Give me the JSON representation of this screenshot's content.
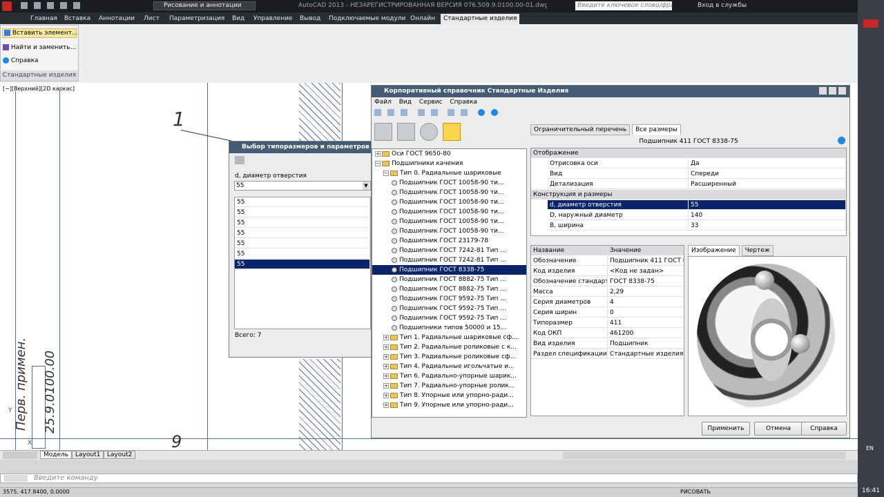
{
  "app": {
    "title": "AutoCAD 2013 - НЕЗАРЕГИСТРИРОВАННАЯ ВЕРСИЯ    076.509.9.0100.00-01.dwg",
    "workspace": "Рисование и аннотации",
    "search_placeholder": "Введите ключевое слово/фразу",
    "signin": "Вход в службы"
  },
  "ribbon_tabs": [
    "Главная",
    "Вставка",
    "Аннотации",
    "Лист",
    "Параметризация",
    "Вид",
    "Управление",
    "Вывод",
    "Подключаемые модули",
    "Онлайн",
    "Стандартные изделия"
  ],
  "panel": {
    "items": [
      "Вставить элемент...",
      "Найти и заменить...",
      "Справка"
    ],
    "title": "Стандартные изделия"
  },
  "viewport_label": "[−][Верхний][2D каркас]",
  "drawing": {
    "leader_1": "1",
    "leader_9": "9",
    "vert_text_1": "Перв. примен.",
    "vert_text_2": "25.9.0100.00",
    "axis_y": "Y",
    "axis_x": "X"
  },
  "param_dialog": {
    "title": "Выбор типоразмеров и параметров",
    "field_label": "d, диаметр отверстия",
    "field_value": "55",
    "list": [
      "55",
      "55",
      "55",
      "55",
      "55",
      "55",
      "55"
    ],
    "selected_index": 6,
    "total": "Всего: 7"
  },
  "main_dialog": {
    "title": "Корпоративный справочник Стандартные Изделия",
    "menu": [
      "Файл",
      "Вид",
      "Сервис",
      "Справка"
    ],
    "tabs": [
      "Ограничительный перечень",
      "Все размеры"
    ],
    "header": "Подшипник 411 ГОСТ 8338-75",
    "tree": [
      {
        "level": 1,
        "icon": "folder",
        "exp": "+",
        "text": "Оси ГОСТ 9650-80"
      },
      {
        "level": 1,
        "icon": "folder",
        "exp": "−",
        "text": "Подшипники качения"
      },
      {
        "level": 2,
        "icon": "folder",
        "exp": "−",
        "text": "Тип 0. Радиальные шариковые"
      },
      {
        "level": 3,
        "icon": "part",
        "text": "Подшипник ГОСТ 10058-90 ти..."
      },
      {
        "level": 3,
        "icon": "part",
        "text": "Подшипник ГОСТ 10058-90 ти..."
      },
      {
        "level": 3,
        "icon": "part",
        "text": "Подшипник ГОСТ 10058-90 ти..."
      },
      {
        "level": 3,
        "icon": "part",
        "text": "Подшипник ГОСТ 10058-90 ти..."
      },
      {
        "level": 3,
        "icon": "part",
        "text": "Подшипник ГОСТ 10058-90 ти..."
      },
      {
        "level": 3,
        "icon": "part",
        "text": "Подшипник ГОСТ 10058-90 ти..."
      },
      {
        "level": 3,
        "icon": "part",
        "text": "Подшипник ГОСТ 23179-78"
      },
      {
        "level": 3,
        "icon": "part",
        "text": "Подшипник ГОСТ 7242-81 Тип ..."
      },
      {
        "level": 3,
        "icon": "part",
        "text": "Подшипник ГОСТ 7242-81 Тип ..."
      },
      {
        "level": 3,
        "icon": "part",
        "text": "Подшипник ГОСТ 8338-75",
        "selected": true
      },
      {
        "level": 3,
        "icon": "part",
        "text": "Подшипник ГОСТ 8882-75 Тип ..."
      },
      {
        "level": 3,
        "icon": "part",
        "text": "Подшипник ГОСТ 8882-75 Тип ..."
      },
      {
        "level": 3,
        "icon": "part",
        "text": "Подшипник ГОСТ 9592-75 Тип ..."
      },
      {
        "level": 3,
        "icon": "part",
        "text": "Подшипник ГОСТ 9592-75 Тип ..."
      },
      {
        "level": 3,
        "icon": "part",
        "text": "Подшипник ГОСТ 9592-75 Тип ..."
      },
      {
        "level": 3,
        "icon": "part",
        "text": "Подшипники типов 50000 и 15..."
      },
      {
        "level": 2,
        "icon": "folder",
        "exp": "+",
        "text": "Тип 1. Радиальные шариковые сф..."
      },
      {
        "level": 2,
        "icon": "folder",
        "exp": "+",
        "text": "Тип 2. Радиальные роликовые с к..."
      },
      {
        "level": 2,
        "icon": "folder",
        "exp": "+",
        "text": "Тип 3. Радиальные роликовые сф..."
      },
      {
        "level": 2,
        "icon": "folder",
        "exp": "+",
        "text": "Тип 4. Радиальные игольчатые и..."
      },
      {
        "level": 2,
        "icon": "folder",
        "exp": "+",
        "text": "Тип 6. Радиально-упорные шарик..."
      },
      {
        "level": 2,
        "icon": "folder",
        "exp": "+",
        "text": "Тип 7. Радиально-упорные ролик..."
      },
      {
        "level": 2,
        "icon": "folder",
        "exp": "+",
        "text": "Тип 8. Упорные или упорно-ради..."
      },
      {
        "level": 2,
        "icon": "folder",
        "exp": "+",
        "text": "Тип 9. Упорные или упорно-ради..."
      }
    ],
    "props": [
      {
        "group": "Отображение"
      },
      {
        "name": "Отрисовка оси",
        "value": "Да"
      },
      {
        "name": "Вид",
        "value": "Спереди"
      },
      {
        "name": "Детализация",
        "value": "Расширенный"
      },
      {
        "group": "Конструкция и размеры"
      },
      {
        "name": "d, диаметр отверстия",
        "value": "55",
        "selected": true
      },
      {
        "name": "D, наружный диаметр",
        "value": "140"
      },
      {
        "name": "B, ширина",
        "value": "33"
      }
    ],
    "attr_headers": [
      "Название",
      "Значение"
    ],
    "attrs": [
      [
        "Обозначение",
        "Подшипник 411 ГОСТ 83"
      ],
      [
        "Код изделия",
        "<Код не задан>"
      ],
      [
        "Обозначение стандарта",
        "ГОСТ 8338-75"
      ],
      [
        "Масса",
        "2,29"
      ],
      [
        "Серия диаметров",
        "4"
      ],
      [
        "Серия ширин",
        "0"
      ],
      [
        "Типоразмер",
        "411"
      ],
      [
        "Код ОКП",
        "461200"
      ],
      [
        "Вид изделия",
        "Подшипник"
      ],
      [
        "Раздел спецификации",
        "Стандартные изделия"
      ]
    ],
    "image_tabs": [
      "Изображение",
      "Чертеж"
    ],
    "buttons": [
      "Применить",
      "Отмена",
      "Справка"
    ]
  },
  "model_tabs": [
    "Модель",
    "Layout1",
    "Layout2"
  ],
  "command_placeholder": "Введите команду",
  "status": {
    "coords": "3575, 417.8400, 0.0000",
    "mode": "РИСОВАТЬ",
    "time": "16:41",
    "lang": "EN"
  }
}
